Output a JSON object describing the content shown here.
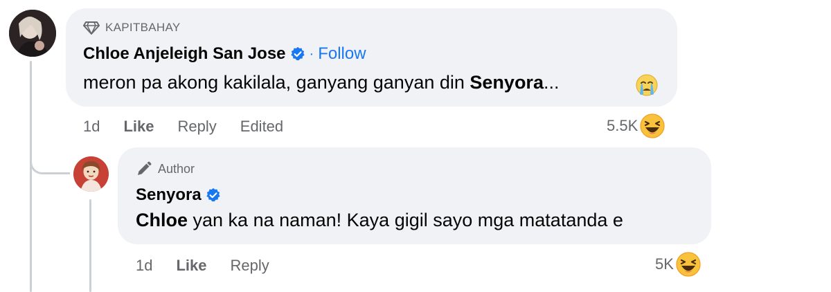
{
  "comment": {
    "badge": "KAPITBAHAY",
    "author": "Chloe Anjeleigh San Jose",
    "separator": "·",
    "follow_label": "Follow",
    "text_prefix": "meron pa akong kakilala, ganyang ganyan din ",
    "text_bold": "Senyora",
    "text_suffix": "...",
    "time": "1d",
    "like_label": "Like",
    "reply_label": "Reply",
    "edited_label": "Edited",
    "reaction_count": "5.5K",
    "reaction_icon": "haha-emoji",
    "inline_emoji": "crying-face-emoji"
  },
  "reply": {
    "badge": "Author",
    "author": "Senyora",
    "text_bold": "Chloe",
    "text_suffix": " yan ka na naman! Kaya gigil sayo mga matatanda e",
    "time": "1d",
    "like_label": "Like",
    "reply_label": "Reply",
    "reaction_count": "5K",
    "reaction_icon": "haha-emoji"
  },
  "colors": {
    "bubble": "#f0f2f5",
    "link": "#1877f2",
    "meta": "#65676b",
    "thread_line": "#ccd0d5"
  }
}
